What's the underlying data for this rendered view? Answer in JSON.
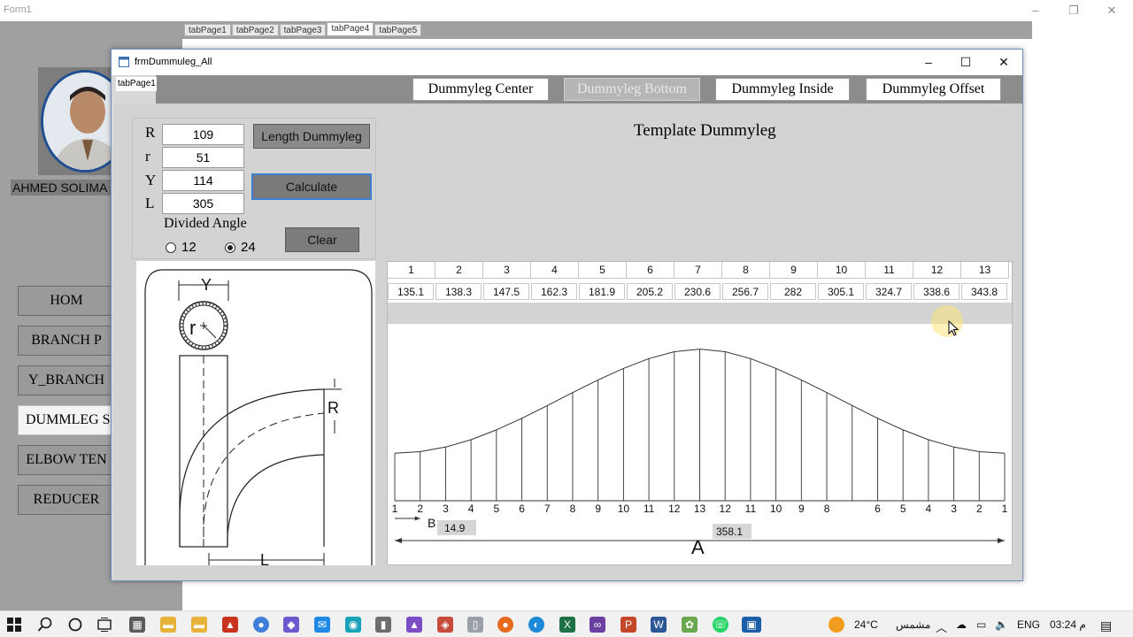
{
  "form1": {
    "title": "Form1",
    "controls": {
      "minimize": "–",
      "restore": "❐",
      "close": "✕"
    },
    "tabs": [
      "tabPage1",
      "tabPage2",
      "tabPage3",
      "tabPage4",
      "tabPage5"
    ],
    "user_name": "AHMED SOLIMA",
    "sidebar": [
      "HOM",
      "BRANCH P",
      "Y_BRANCH",
      "DUMMLEG S",
      "ELBOW TEN",
      "REDUCER"
    ]
  },
  "dialog": {
    "title": "frmDummuleg_All",
    "tab_label": "tabPage1",
    "controls": {
      "minimize": "–",
      "maximize": "☐",
      "close": "✕"
    },
    "mode_buttons": [
      "Dummyleg Center",
      "Dummyleg  Bottom",
      "Dummyleg Inside",
      "Dummyleg Offset"
    ],
    "inputs": {
      "R": {
        "label": "R",
        "value": "109"
      },
      "r": {
        "label": "r",
        "value": "51"
      },
      "Y": {
        "label": "Y",
        "value": "114"
      },
      "L": {
        "label": "L",
        "value": "305"
      }
    },
    "buttons": {
      "length": "Length Dummyleg",
      "calculate": "Calculate",
      "clear": "Clear"
    },
    "divided_angle": {
      "title": "Divided Angle",
      "options": [
        "12",
        "24"
      ],
      "selected": "24"
    },
    "sketch": {
      "label_Y": "Y",
      "label_r": "r",
      "label_R": "R",
      "label_L": "L"
    },
    "template_title": "Template  Dummyleg",
    "table": {
      "headers": [
        "1",
        "2",
        "3",
        "4",
        "5",
        "6",
        "7",
        "8",
        "9",
        "10",
        "11",
        "12",
        "13"
      ],
      "values": [
        "135.1",
        "138.3",
        "147.5",
        "162.3",
        "181.9",
        "205.2",
        "230.6",
        "256.7",
        "282",
        "305.1",
        "324.7",
        "338.6",
        "343.8"
      ]
    },
    "template": {
      "axis_labels": [
        "1",
        "2",
        "3",
        "4",
        "5",
        "6",
        "7",
        "8",
        "9",
        "10",
        "11",
        "12",
        "13",
        "12",
        "11",
        "10",
        "9",
        "8",
        "",
        "6",
        "5",
        "4",
        "3",
        "2",
        "1"
      ],
      "label_A": "A",
      "label_B": "B",
      "value_B": "14.9",
      "value_A": "358.1"
    }
  },
  "taskbar": {
    "temperature": "24°C",
    "weather": "مشمس",
    "language": "ENG",
    "time": "03:24 م"
  }
}
